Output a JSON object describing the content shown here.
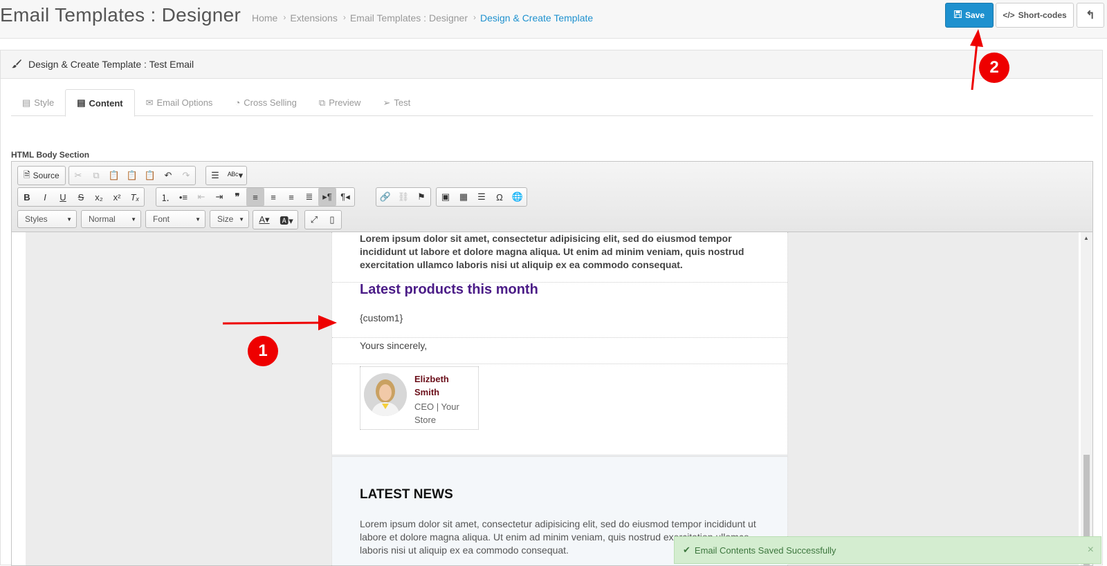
{
  "header": {
    "title": "Email Templates : Designer",
    "breadcrumb": [
      "Home",
      "Extensions",
      "Email Templates : Designer",
      "Design & Create Template"
    ],
    "save_label": "Save",
    "shortcodes_label": "Short-codes"
  },
  "panel": {
    "heading": "Design & Create Template : Test Email"
  },
  "tabs": [
    {
      "label": "Style",
      "active": false
    },
    {
      "label": "Content",
      "active": true
    },
    {
      "label": "Email Options",
      "active": false
    },
    {
      "label": "Cross Selling",
      "active": false
    },
    {
      "label": "Preview",
      "active": false
    },
    {
      "label": "Test",
      "active": false
    }
  ],
  "section_label": "HTML Body Section",
  "toolbar": {
    "source_label": "Source",
    "styles_label": "Styles",
    "format_label": "Normal",
    "font_label": "Font",
    "size_label": "Size"
  },
  "email": {
    "intro": "Lorem ipsum dolor sit amet, consectetur adipisicing elit, sed do eiusmod tempor incididunt ut labore et dolore magna aliqua. Ut enim ad minim veniam, quis nostrud exercitation ullamco laboris nisi ut aliquip ex ea commodo consequat.",
    "products_heading": "Latest products this month",
    "custom_token": "{custom1}",
    "closing": "Yours sincerely,",
    "signature_name": "Elizbeth Smith",
    "signature_role": "CEO | Your Store",
    "news_heading": "LATEST NEWS",
    "news_body": "Lorem ipsum dolor sit amet, consectetur adipisicing elit, sed do eiusmod tempor incididunt ut labore et dolore magna aliqua. Ut enim ad minim veniam, quis nostrud exercitation ullamco laboris nisi ut aliquip ex ea commodo consequat."
  },
  "annotations": {
    "marker1": "1",
    "marker2": "2",
    "color": "#ee0000"
  },
  "toast": {
    "message": "Email Contents Saved Successfully"
  },
  "colors": {
    "primary": "#1e91cf",
    "heading_purple": "#4b1c87",
    "signature_red": "#6b0f1a",
    "toast_bg": "#d4edd0"
  }
}
